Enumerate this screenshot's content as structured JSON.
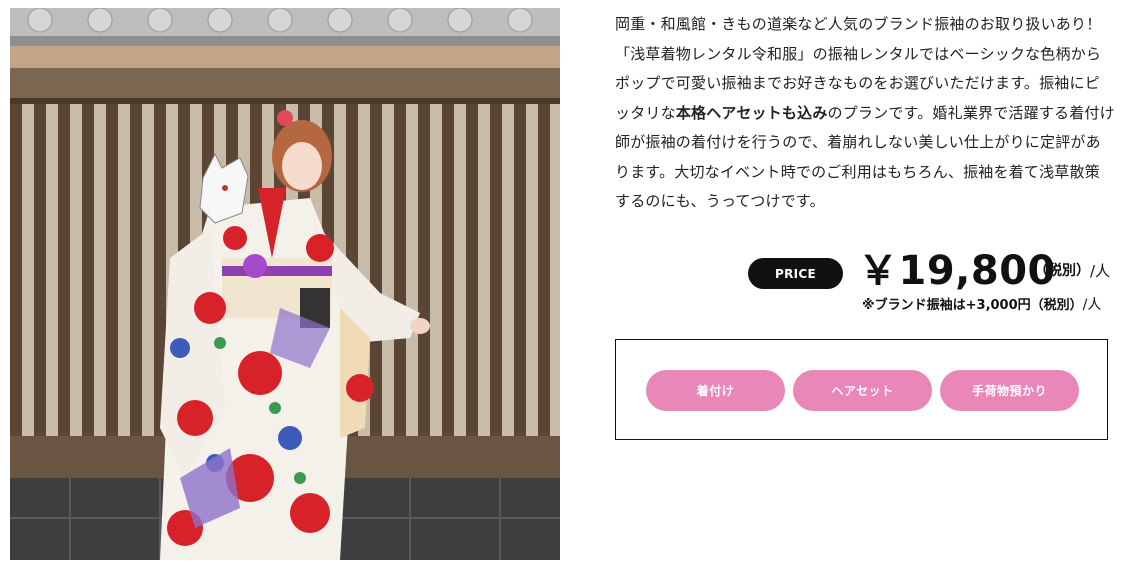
{
  "photo": {
    "alt_kind": "kimono-model-photo"
  },
  "description": {
    "part1": "岡重・和風館・きもの道楽など人気のブランド振袖のお取り扱いあり！「浅草着物レンタル令和服」の振袖レンタルではベーシックな色柄からポップで可愛い振袖までお好きなものをお選びいただけます。振袖にピッタリな",
    "bold": "本格ヘアセットも込み",
    "part2": "のプランです。婚礼業界で活躍する着付け師が振袖の着付けを行うので、着崩れしない美しい仕上がりに定評があります。大切なイベント時でのご利用はもちろん、振袖を着て浅草散策するのにも、うってつけです。"
  },
  "price": {
    "badge": "PRICE",
    "amount": "￥19,800",
    "tax": "（税別）",
    "unit": "/人",
    "note": "※ブランド振袖は+3,000円（税別）",
    "note_unit": "/人"
  },
  "options": {
    "items": [
      "着付け",
      "ヘアセット",
      "手荷物預かり"
    ]
  },
  "colors": {
    "accent_pink": "#e887b8",
    "badge_black": "#111111"
  }
}
